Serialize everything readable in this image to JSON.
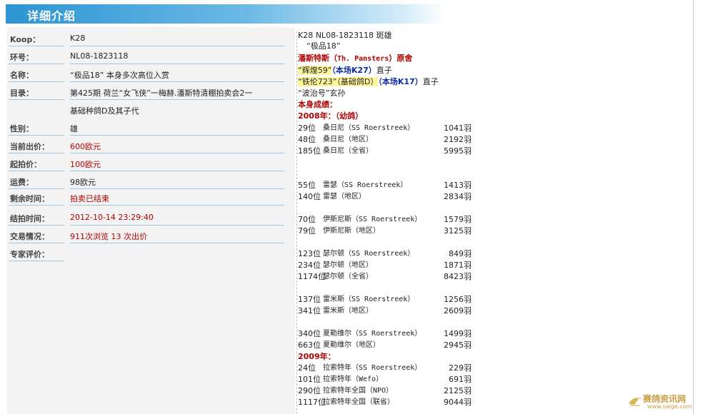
{
  "header": {
    "title": "详细介绍"
  },
  "details": [
    {
      "label": "Koop：",
      "value": "K28"
    },
    {
      "label": "环号：",
      "value": "NL08-1823118"
    },
    {
      "label": "名称：",
      "value": "“极品18”  本身多次高位入赏"
    },
    {
      "label": "目录：",
      "value": "第425期 荷兰“女飞侠”一梅赫.潘斯特清棚拍卖会2一",
      "value2": "基础种鸽D及其子代"
    },
    {
      "label": "性别：",
      "value": "雄"
    },
    {
      "label": "当前出价：",
      "value": "600欧元"
    },
    {
      "label": "起拍价：",
      "value": "100欧元"
    },
    {
      "label": "运费：",
      "value": "98欧元"
    },
    {
      "label": "剩余时间：",
      "value": "拍卖已结束"
    },
    {
      "label": "结拍时间：",
      "value": "2012-10-14 23:29:40"
    },
    {
      "label": "交易情况：",
      "value": "911次浏览    13 次出价"
    },
    {
      "label": "专家评价：",
      "value": ""
    }
  ],
  "pedigree": {
    "line1": "K28  NL08-1823118 斑雄",
    "line2": "“极品18”",
    "origin_a": "潘斯特斯（",
    "origin_b": "Th. Pansters",
    "origin_c": "）原舍",
    "p1_name": "“辉煌59”",
    "p1_tag": "（本场K27）",
    "p1_suffix": "直子",
    "p2_name": "“铁伦723”（基础鸽D）",
    "p2_tag": "（本场K17）",
    "p2_suffix": "直子",
    "p3": "“波治号”玄孙",
    "results_title": "本身成绩：",
    "year_2008": "2008年：（幼鸽）",
    "year_2009": "2009年："
  },
  "results_2008": [
    {
      "rank": "29位",
      "place": "桑日尼（SS Roerstreek）",
      "count": "1041羽"
    },
    {
      "rank": "48位",
      "place": "桑日尼（地区）",
      "count": "2192羽"
    },
    {
      "rank": "185位",
      "place": "桑日尼（全省）",
      "count": "5995羽"
    },
    {
      "rank": "55位",
      "place": "雷瑟（SS Roerstreek）",
      "count": "1413羽"
    },
    {
      "rank": "140位",
      "place": "雷瑟（地区）",
      "count": "2834羽"
    },
    {
      "rank": "70位",
      "place": "伊斯尼斯（SS Roerstreek）",
      "count": "1579羽"
    },
    {
      "rank": "79位",
      "place": "伊斯尼斯（地区）",
      "count": "3125羽"
    },
    {
      "rank": "123位",
      "place": "瑟尔顿（SS Roerstreek）",
      "count": "849羽"
    },
    {
      "rank": "234位",
      "place": "瑟尔顿（地区）",
      "count": "1871羽"
    },
    {
      "rank": "1174位",
      "place": "瑟尔顿（全省）",
      "count": "8423羽"
    },
    {
      "rank": "137位",
      "place": "雷米斯（SS Roerstreek）",
      "count": "1256羽"
    },
    {
      "rank": "341位",
      "place": "雷米斯（地区）",
      "count": "2609羽"
    },
    {
      "rank": "340位",
      "place": "夏勒维尔（SS Roerstreek）",
      "count": "1499羽"
    },
    {
      "rank": "663位",
      "place": "夏勒维尔（地区）",
      "count": "2945羽"
    }
  ],
  "results_2009": [
    {
      "rank": "24位",
      "place": "拉索特年（SS Roerstreek）",
      "count": "229羽"
    },
    {
      "rank": "101位",
      "place": "拉索特年（Wefo）",
      "count": "691羽"
    },
    {
      "rank": "290位",
      "place": "拉索特年全国（NPO）",
      "count": "2125羽"
    },
    {
      "rank": "1117位",
      "place": "拉索特年全国（联省）",
      "count": "9044羽"
    }
  ],
  "watermark": {
    "text": "赛鸽资讯网",
    "url": "www.saige.com"
  }
}
